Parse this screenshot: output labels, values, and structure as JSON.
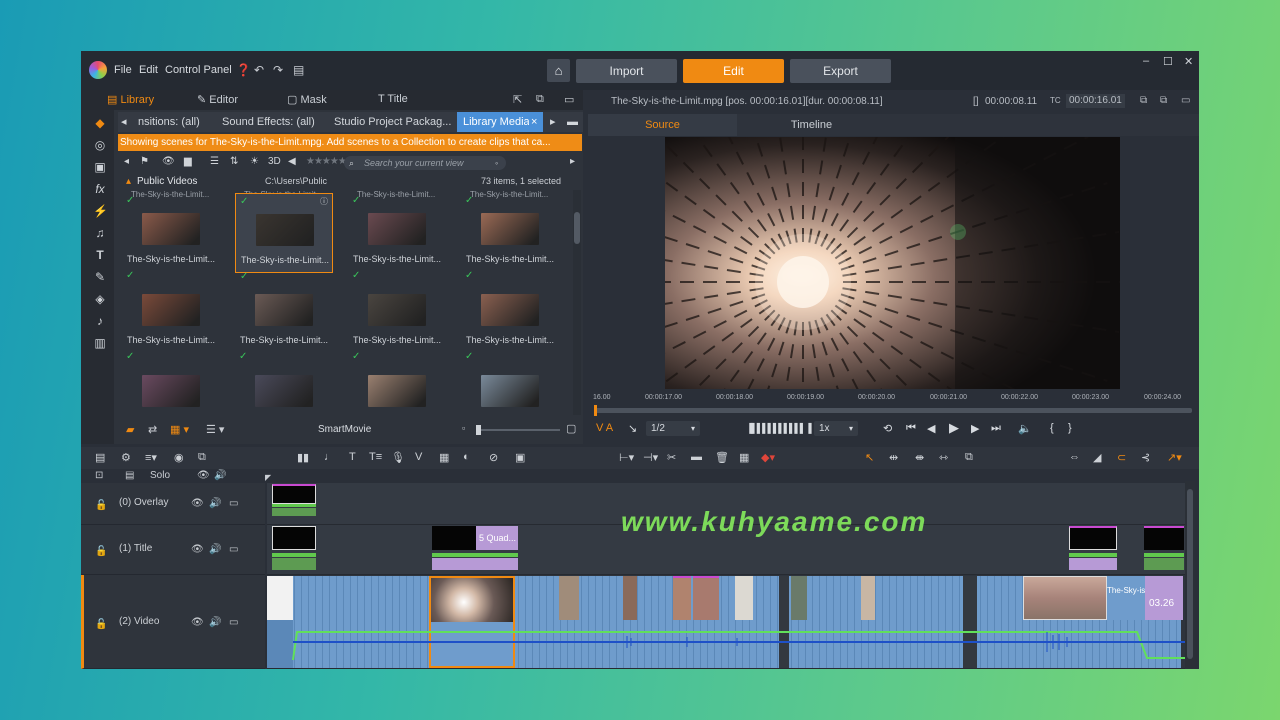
{
  "app": {
    "menu": [
      "File",
      "Edit",
      "Control Panel"
    ],
    "modes": [
      {
        "label": "Import",
        "active": false
      },
      {
        "label": "Edit",
        "active": true
      },
      {
        "label": "Export",
        "active": false
      }
    ],
    "window_controls": [
      "–",
      "☐",
      "✕"
    ]
  },
  "library": {
    "tabs": [
      {
        "label": "Library",
        "active": true
      },
      {
        "label": "Editor",
        "active": false
      },
      {
        "label": "Mask",
        "active": false
      },
      {
        "label": "Title",
        "active": false
      }
    ],
    "collection_tabs": [
      {
        "label": "nsitions: (all)",
        "selected": false
      },
      {
        "label": "Sound Effects: (all)",
        "selected": false
      },
      {
        "label": "Studio Project Packag...",
        "selected": false
      },
      {
        "label": "Library Media",
        "selected": true
      }
    ],
    "notice": "Showing scenes for The-Sky-is-the-Limit.mpg. Add scenes to a Collection to create clips that ca...",
    "search_placeholder": "Search your current view",
    "folder_name": "Public Videos",
    "folder_path": "C:\\Users\\Public",
    "item_count": "73 items, 1 selected",
    "top_row_label": "The-Sky-is-the-Limit...",
    "clips": [
      {
        "name": "The-Sky-is-the-Limit...",
        "color": "#8a5a4a"
      },
      {
        "name": "The-Sky-is-the-Limit...",
        "color": "#3a3530"
      },
      {
        "name": "The-Sky-is-the-Limit...",
        "color": "#6a4a50"
      },
      {
        "name": "The-Sky-is-the-Limit...",
        "color": "#9a6a55"
      },
      {
        "name": "The-Sky-is-the-Limit...",
        "color": "#7a4a3a"
      },
      {
        "name": "The-Sky-is-the-Limit...",
        "color": "#6a5a55"
      },
      {
        "name": "The-Sky-is-the-Limit...",
        "color": "#4a4540"
      },
      {
        "name": "The-Sky-is-the-Limit...",
        "color": "#8a6050"
      },
      {
        "name": "",
        "color": "#6a4a60"
      },
      {
        "name": "",
        "color": "#4a4a5a"
      },
      {
        "name": "",
        "color": "#9a8070"
      },
      {
        "name": "",
        "color": "#7a8a9a"
      }
    ],
    "selected_index": 1,
    "smartmovie_label": "SmartMovie"
  },
  "player": {
    "title": "The-Sky-is-the-Limit.mpg [pos. 00:00:16.01][dur. 00:00:08.11]",
    "duration": "00:00:08.11",
    "tc_label": "TC",
    "timecode": "00:00:16.01",
    "tabs": [
      {
        "label": "Source",
        "active": true
      },
      {
        "label": "Timeline",
        "active": false
      }
    ],
    "ruler_ticks": [
      "16.00",
      "00:00:17.00",
      "00:00:18.00",
      "00:00:19.00",
      "00:00:20.00",
      "00:00:21.00",
      "00:00:22.00",
      "00:00:23.00",
      "00:00:24.00"
    ],
    "va_label": "V A",
    "fraction": "1/2",
    "speed": "1x"
  },
  "timeline": {
    "solo_label": "Solo",
    "tracks": [
      {
        "name": "(0) Overlay"
      },
      {
        "name": "(1) Title"
      },
      {
        "name": "(2) Video"
      }
    ],
    "title_clip_label": "5 Quad...",
    "video_end_label": "The-Sky-is-...",
    "video_end_time": "03.26"
  },
  "watermark": "www.kuhyaame.com"
}
